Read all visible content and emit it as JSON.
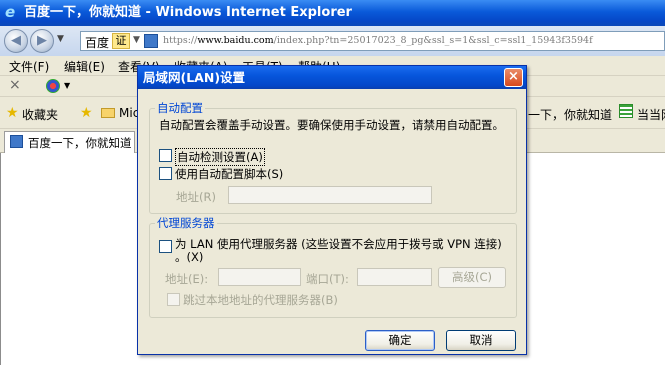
{
  "browser": {
    "window_title": "百度一下，你就知道 - Windows Internet Explorer",
    "address": {
      "site_label": "百度",
      "cert_label": "证",
      "url_prefix": "https://",
      "url_host": "www.baidu.com",
      "url_path": "/index.php?tn=25017023_8_pg&ssl_s=1&ssl_c=ssl1_15943f3594f"
    },
    "menu": [
      "文件(F)",
      "编辑(E)",
      "查看(V)",
      "收藏夹(A)",
      "工具(T)",
      "帮助(H)"
    ],
    "favorites": {
      "label": "收藏夹",
      "folder_label": "Mic",
      "right_item_1": "一下，你就知道",
      "right_item_2": "当当网"
    },
    "tab": {
      "label": "百度一下，你就知道"
    }
  },
  "dialog": {
    "title": "局域网(LAN)设置",
    "close_icon": "×",
    "auto_config": {
      "legend": "自动配置",
      "description": "自动配置会覆盖手动设置。要确保使用手动设置，请禁用自动配置。",
      "auto_detect_label": "自动检测设置(A)",
      "auto_detect_checked": false,
      "use_script_label": "使用自动配置脚本(S)",
      "use_script_checked": false,
      "address_label": "地址(R)",
      "address_value": ""
    },
    "proxy": {
      "legend": "代理服务器",
      "use_proxy_label_line1": "为 LAN 使用代理服务器 (这些设置不会应用于拨号或 VPN 连接)",
      "use_proxy_label_line2": "。(X)",
      "use_proxy_checked": false,
      "address_label": "地址(E):",
      "address_value": "",
      "port_label": "端口(T):",
      "port_value": "",
      "advanced_button": "高级(C)",
      "bypass_label": "跳过本地地址的代理服务器(B)",
      "bypass_checked": false
    },
    "ok_button": "确定",
    "cancel_button": "取消"
  },
  "colors": {
    "title_bar": "#0756dc",
    "dialog_bg": "#ece9d8",
    "legend_text": "#0046d5",
    "close_button": "#d8491c"
  }
}
